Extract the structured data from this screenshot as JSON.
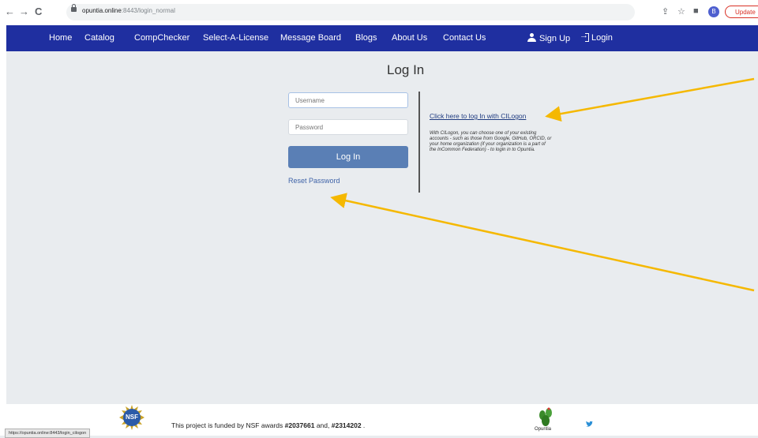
{
  "browser": {
    "back_icon": "←",
    "forward_icon": "→",
    "reload_icon": "C",
    "url_host": "opuntia.online",
    "url_path": ":8443/login_normal",
    "profile_initial": "B",
    "update_label": "Update",
    "status_url": "https://opuntia.online:8443/login_cilogon"
  },
  "navbar": {
    "items": [
      "Home",
      "Catalog",
      "CompChecker",
      "Select-A-License",
      "Message Board",
      "Blogs",
      "About Us",
      "Contact Us"
    ],
    "signup_label": "Sign Up",
    "login_label": "Login"
  },
  "login": {
    "title": "Log In",
    "username_placeholder": "Username",
    "password_placeholder": "Password",
    "button_label": "Log In",
    "reset_label": "Reset Password"
  },
  "cilogon": {
    "link_label": "Click here to log In with CILogon",
    "description": "With CILogon, you can choose one of your existing accounts - such as those from Google, GitHub, ORCID, or your home organization (if your organization is a part of the InCommon Federation) - to login in to Opuntia."
  },
  "footer": {
    "nsf_logo_text": "NSF",
    "funding_prefix": "This project is funded by NSF awards ",
    "award1": "#2037661",
    "funding_mid": " and, ",
    "award2": "#2314202",
    "funding_suffix": " .",
    "opuntia_name": "Opuntia"
  },
  "colors": {
    "navbar_bg": "#1f2fa0",
    "button_bg": "#5a7fb5",
    "annotation_arrow": "#f5b800"
  }
}
